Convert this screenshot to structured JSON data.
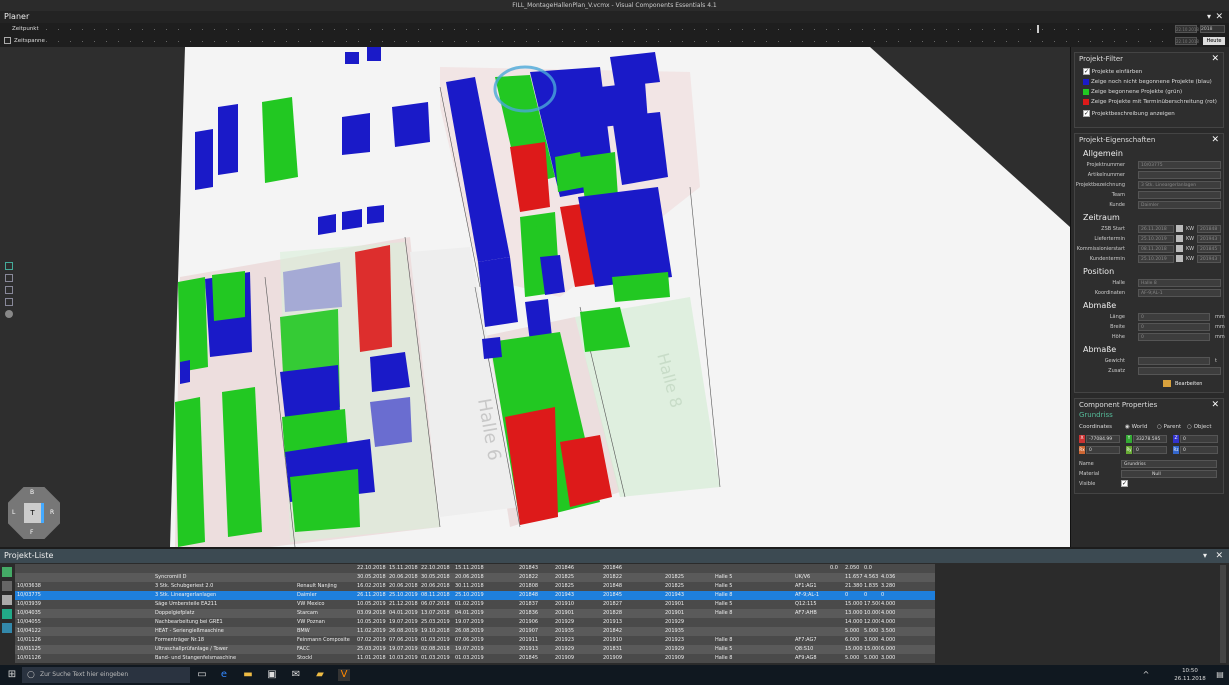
{
  "window": {
    "title": "FILL_MontageHallenPlan_V.vcmx - Visual Components Essentials 4.1"
  },
  "planer": {
    "title": "Planer"
  },
  "timeline": {
    "zeitpunkt_label": "Zeitpunkt",
    "zeitspanne_label": "Zeitspanne",
    "date_value": "22.10.2018",
    "year_value": "2018",
    "date2_value": "22.10.2018",
    "today_button": "Heute"
  },
  "viewport": {
    "hall_label": "Halle 6",
    "hall_label_2": "Halle 8",
    "nav_cube": {
      "top": "B",
      "front": "F",
      "left": "L",
      "right": "R",
      "center": "T"
    }
  },
  "filter": {
    "title": "Projekt-Filter",
    "items": [
      "Projekte einfärben",
      "Zeige noch nicht begonnene Projekte (blau)",
      "Zeige begonnene Projekte (grün)",
      "Zeige Projekte mit Terminüberschreitung (rot)",
      "Projektbeschreibung anzeigen"
    ]
  },
  "props": {
    "title": "Projekt-Eigenschaften",
    "allgemein": "Allgemein",
    "projektnummer_label": "Projektnummer",
    "projektnummer": "10/03775",
    "artikelnummer_label": "Artikelnummer",
    "artikelnummer": "",
    "projektbezeichnung_label": "Projektbezeichnung",
    "projektbezeichnung": "3 Stk. Lineargerlanlagen",
    "team_label": "Team",
    "team": "",
    "kunde_label": "Kunde",
    "kunde": "Daimler",
    "zeitraum": "Zeitraum",
    "zsb_label": "ZSB Start",
    "zsb": "26.11.2018",
    "liefer_label": "Liefertermin",
    "liefer": "25.10.2019",
    "komm_label": "Kommissionierstart",
    "komm": "08.11.2018",
    "kunden_label": "Kundentermin",
    "kunden": "25.10.2019",
    "kw_label": "KW",
    "zsb_kw": "201848",
    "liefer_kw": "201943",
    "komm_kw": "201845",
    "kunden_kw": "201943",
    "position": "Position",
    "halle_label": "Halle",
    "halle": "Halle 8",
    "koord_label": "Koordinaten",
    "koord": "AF-9;AL-1",
    "abmasse": "Abmaße",
    "laenge_label": "Länge",
    "laenge": "0",
    "breite_label": "Breite",
    "breite": "0",
    "hoehe_label": "Höhe",
    "hoehe": "0",
    "mm": "mm",
    "abmasse2": "Abmaße",
    "gewicht_label": "Gewicht",
    "gewicht": "",
    "t_unit": "t",
    "zusatz_label": "Zusatz",
    "zusatz": "",
    "edit_button": "Bearbeiten"
  },
  "component": {
    "title": "Component Properties",
    "name_heading": "Grundriss",
    "coords_label": "Coordinates",
    "world": "World",
    "parent": "Parent",
    "object": "Object",
    "x": "-77084.99",
    "y": "33278.595",
    "z": "0",
    "rx": "0",
    "ry": "0",
    "rz": "0",
    "name_label": "Name",
    "name": "Grundriss",
    "material_label": "Material",
    "material": "Null",
    "visible_label": "Visible"
  },
  "projlist": {
    "title": "Projekt-Liste",
    "rows": [
      [
        "",
        "",
        "",
        "22.10.2018",
        "15.11.2018",
        "22.10.2018",
        "",
        "15.11.2018",
        "201843",
        "",
        "201846",
        "",
        "201846",
        "",
        "",
        "",
        "",
        "",
        "0.0",
        "2.050",
        "0.0"
      ],
      [
        "",
        "Syncromill D",
        "",
        "30.05.2018",
        "20.06.2018",
        "30.05.2018",
        "",
        "20.06.2018",
        "201822",
        "",
        "201825",
        "",
        "201822",
        "",
        "201825",
        "Halle 5",
        "",
        "UK/V6",
        "",
        "11.657",
        "4.563",
        "4.036"
      ],
      [
        "10/03638",
        "3 Stk. Schubgeriest 2.0",
        "Renault Nanjing",
        "16.02.2018",
        "20.06.2018",
        "20.06.2018",
        "",
        "30.11.2018",
        "201808",
        "",
        "201825",
        "",
        "201848",
        "",
        "201825",
        "Halle 5",
        "",
        "AF1:AG1",
        "",
        "21.380",
        "1.835",
        "3.280"
      ],
      [
        "10/03775",
        "3 Stk. Lineargerlanlagen",
        "Daimler",
        "26.11.2018",
        "25.10.2019",
        "08.11.2018",
        "",
        "25.10.2019",
        "201848",
        "",
        "201943",
        "",
        "201845",
        "",
        "201943",
        "Halle 8",
        "",
        "AF-9;AL-1",
        "",
        "0",
        "0",
        "0"
      ],
      [
        "10/03939",
        "Säge Umbersteile EA211",
        "VW Mexico",
        "10.05.2019",
        "21.12.2018",
        "06.07.2018",
        "",
        "01.02.2019",
        "201837",
        "",
        "201910",
        "",
        "201827",
        "",
        "201901",
        "Halle 5",
        "",
        "Q12:115",
        "",
        "15.000",
        "17.500",
        "4.000"
      ],
      [
        "10/04035",
        "Doppelgiefplatz",
        "Starcam",
        "03.09.2018",
        "04.01.2019",
        "13.07.2018",
        "",
        "04.01.2019",
        "201836",
        "",
        "201901",
        "",
        "201828",
        "",
        "201901",
        "Halle 8",
        "",
        "AF7:AHB",
        "",
        "13.000",
        "10.000",
        "4.000"
      ],
      [
        "10/04055",
        "Nachbearbeitung bei GRE1",
        "VW Poznan",
        "10.05.2019",
        "19.07.2019",
        "25.03.2019",
        "",
        "19.07.2019",
        "201906",
        "",
        "201929",
        "",
        "201913",
        "",
        "201929",
        "",
        "",
        "",
        "",
        "14.000",
        "12.000",
        "4.000"
      ],
      [
        "10/04122",
        "HEAT - Seriengießmaschine",
        "BMW",
        "11.02.2019",
        "26.08.2019",
        "19.10.2018",
        "",
        "26.08.2019",
        "201907",
        "",
        "201935",
        "",
        "201842",
        "",
        "201935",
        "",
        "",
        "",
        "",
        "5.000",
        "5.000",
        "3.500"
      ],
      [
        "10/01126",
        "Formenträger Nr.18",
        "Feinmann Composite",
        "07.02.2019",
        "07.06.2019",
        "01.03.2019",
        "",
        "07.06.2019",
        "201911",
        "",
        "201923",
        "",
        "201910",
        "",
        "201923",
        "Halle 8",
        "",
        "AF7:AG7",
        "",
        "6.000",
        "3.000",
        "4.000"
      ],
      [
        "10/01125",
        "Ultraschallprüfanlage / Tower",
        "FACC",
        "25.03.2019",
        "19.07.2019",
        "02.08.2018",
        "",
        "19.07.2019",
        "201913",
        "",
        "201929",
        "",
        "201831",
        "",
        "201929",
        "Halle 5",
        "",
        "Q8:S10",
        "",
        "15.000",
        "15.000",
        "6.000"
      ],
      [
        "10/01126",
        "Band- und Stangenfelsmaschine",
        "Stockl",
        "11.01.2018",
        "10.03.2019",
        "01.03.2019",
        "",
        "01.03.2019",
        "201845",
        "",
        "201909",
        "",
        "201909",
        "",
        "201909",
        "Halle 8",
        "",
        "AF9:AG8",
        "",
        "5.000",
        "5.000",
        "3.000"
      ]
    ]
  },
  "taskbar": {
    "search_placeholder": "Zur Suche Text hier eingeben",
    "time": "10:50",
    "date": "26.11.2018"
  }
}
